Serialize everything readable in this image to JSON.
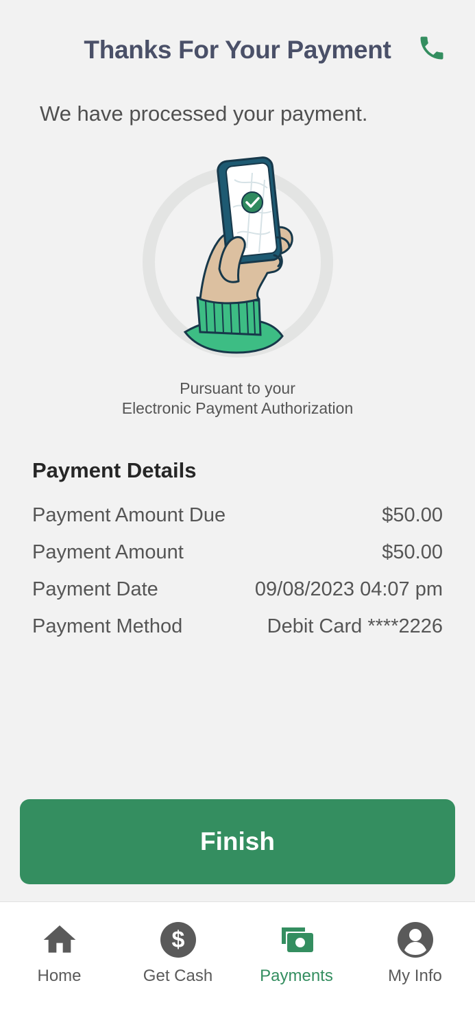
{
  "header": {
    "title": "Thanks For Your Payment",
    "call_icon": "phone-icon"
  },
  "confirmation": {
    "message": "We have processed your payment."
  },
  "illustration": {
    "icon": "hand-holding-phone-checkmark"
  },
  "authorization": {
    "line1": "Pursuant to your",
    "line2": "Electronic Payment Authorization"
  },
  "payment_details": {
    "title": "Payment Details",
    "rows": [
      {
        "label": "Payment Amount Due",
        "value": "$50.00"
      },
      {
        "label": "Payment Amount",
        "value": "$50.00"
      },
      {
        "label": "Payment Date",
        "value": "09/08/2023 04:07 pm"
      },
      {
        "label": "Payment Method",
        "value": "Debit Card ****2226"
      }
    ]
  },
  "actions": {
    "finish_label": "Finish"
  },
  "bottom_nav": {
    "items": [
      {
        "label": "Home",
        "icon": "home-icon",
        "active": false
      },
      {
        "label": "Get Cash",
        "icon": "dollar-icon",
        "active": false
      },
      {
        "label": "Payments",
        "icon": "payments-icon",
        "active": true
      },
      {
        "label": "My Info",
        "icon": "account-icon",
        "active": false
      }
    ]
  },
  "colors": {
    "brand_green": "#348e60",
    "background": "#f2f2f2",
    "title_text": "#4a5068",
    "nav_inactive": "#5a5a5a"
  }
}
